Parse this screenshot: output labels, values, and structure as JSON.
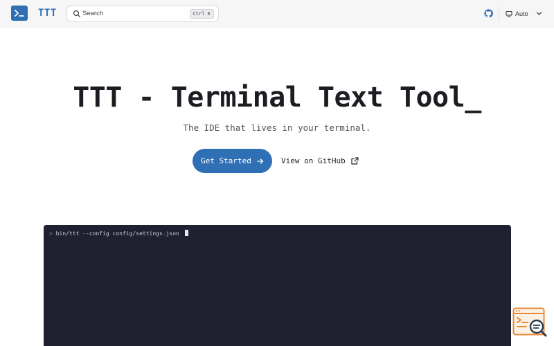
{
  "header": {
    "brand": "TTT",
    "logo_icon": "terminal-prompt-icon",
    "search": {
      "placeholder": "Search",
      "shortcut": "Ctrl K"
    },
    "github_icon": "github-icon",
    "theme": {
      "label": "Auto",
      "icon": "monitor-icon"
    }
  },
  "hero": {
    "title": "TTT - Terminal Text Tool_",
    "tagline": "The IDE that lives in your terminal.",
    "primary_button": "Get Started",
    "secondary_button": "View on GitHub"
  },
  "terminal": {
    "prompt": ">",
    "command": "bin/ttt --config config/settings.json"
  },
  "colors": {
    "accent": "#2f6fb3",
    "topbar_bg": "#f6f6f7",
    "terminal_bg": "#1f2030",
    "badge_orange": "#e8893a"
  }
}
